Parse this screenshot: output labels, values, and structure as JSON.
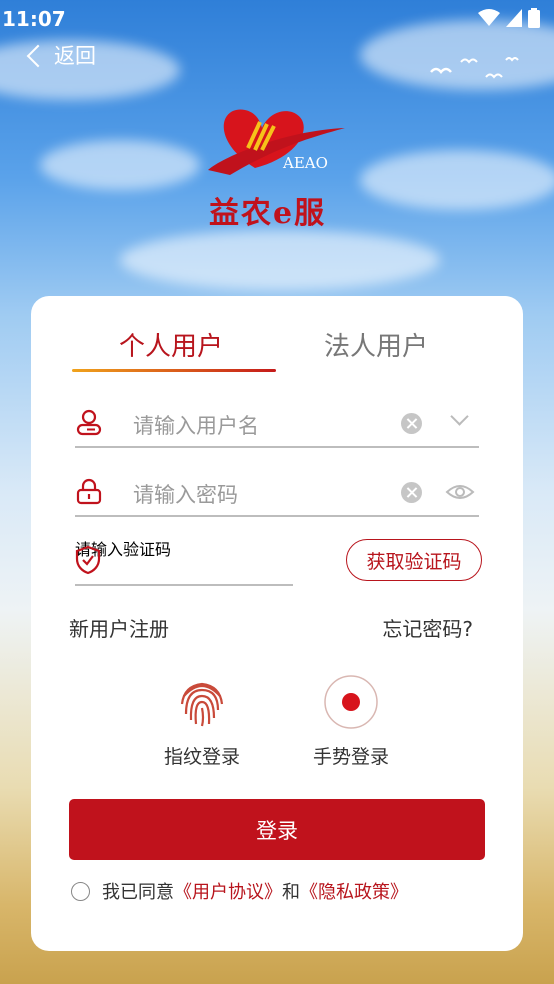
{
  "status_bar": {
    "time": "11:07"
  },
  "header": {
    "back_label": "返回"
  },
  "brand": {
    "name": "益农e服",
    "sub": "AEAO"
  },
  "tabs": [
    {
      "label": "个人用户"
    },
    {
      "label": "法人用户"
    }
  ],
  "form": {
    "username_placeholder": "请输入用户名",
    "password_placeholder": "请输入密码",
    "code_placeholder": "请输入验证码",
    "get_code_label": "获取验证码"
  },
  "links": {
    "register": "新用户注册",
    "forgot": "忘记密码?"
  },
  "alt_login": {
    "fingerprint": "指纹登录",
    "gesture": "手势登录"
  },
  "login_button": "登录",
  "agreement": {
    "prefix": "我已同意",
    "user_agreement": "《用户协议》",
    "and": "和",
    "privacy": "《隐私政策》"
  },
  "colors": {
    "primary": "#c0121c",
    "tab_active": "#b8151d"
  }
}
